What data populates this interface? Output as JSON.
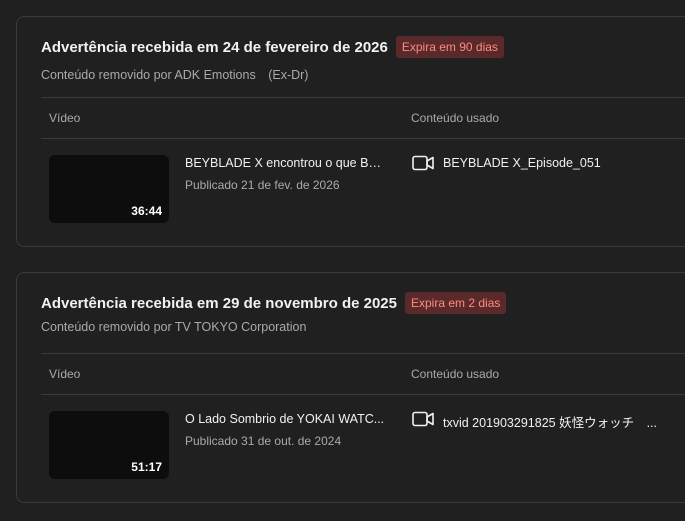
{
  "warnings": [
    {
      "title": "Advertência recebida em 24 de fevereiro de 2026",
      "badge": "Expira em 90 dias",
      "subtitle": "Conteúdo removido por ADK Emotions　(Ex-Dr)",
      "col_video": "Vídeo",
      "col_content": "Conteúdo usado",
      "video_title": "BEYBLADE X encontrou o que Be...",
      "video_date": "Publicado 21 de fev. de 2026",
      "duration": "36:44",
      "content_icon": "video-camera-icon",
      "content_name": "BEYBLADE X_Episode_051"
    },
    {
      "title": "Advertência recebida em 29 de novembro de 2025",
      "badge": "Expira em 2 dias",
      "subtitle": "Conteúdo removido por TV TOKYO Corporation",
      "col_video": "Vídeo",
      "col_content": "Conteúdo usado",
      "video_title": "O Lado Sombrio de YOKAI WATC...",
      "video_date": "Publicado 31 de out. de 2024",
      "duration": "51:17",
      "content_icon": "video-camera-icon",
      "content_name": "txvid 201903291825 妖怪ウォッチ　..."
    }
  ],
  "colors": {
    "background": "#1f1f1f",
    "badge_bg": "#5a2a2a",
    "badge_text": "#ff8a80",
    "muted_text": "#aaaaaa"
  }
}
